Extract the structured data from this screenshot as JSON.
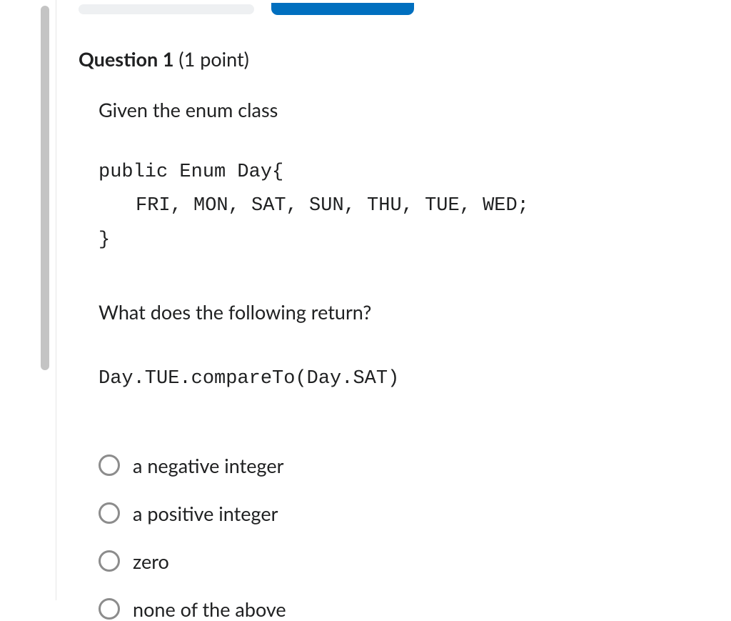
{
  "question": {
    "title_bold": "Question 1",
    "points": " (1 point)",
    "intro": "Given the enum class",
    "code_line1": "public Enum Day{",
    "code_line2": "FRI, MON, SAT, SUN, THU, TUE, WED;",
    "code_line3": "}",
    "prompt": "What does the following return?",
    "expression": "Day.TUE.compareTo(Day.SAT)"
  },
  "options": [
    "a negative integer",
    "a positive integer",
    "zero",
    "none of the above"
  ]
}
